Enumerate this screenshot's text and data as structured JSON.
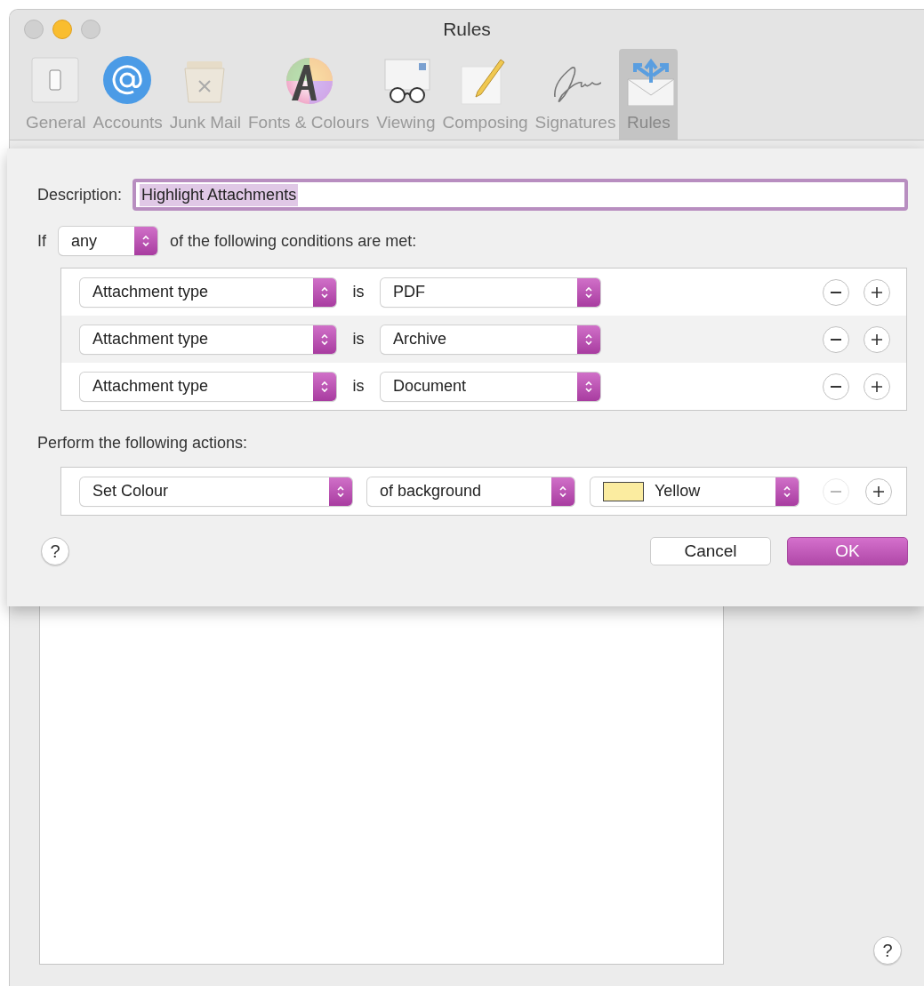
{
  "window": {
    "title": "Rules"
  },
  "toolbar": [
    {
      "label": "General",
      "selected": false
    },
    {
      "label": "Accounts",
      "selected": false
    },
    {
      "label": "Junk Mail",
      "selected": false
    },
    {
      "label": "Fonts & Colours",
      "selected": false
    },
    {
      "label": "Viewing",
      "selected": false
    },
    {
      "label": "Composing",
      "selected": false
    },
    {
      "label": "Signatures",
      "selected": false
    },
    {
      "label": "Rules",
      "selected": true
    }
  ],
  "sheet": {
    "description": {
      "label": "Description:",
      "value": "Highlight Attachments",
      "text_selected": true
    },
    "match": {
      "prefix": "If",
      "value": "any",
      "suffix": "of the following conditions are met:"
    },
    "conditions": [
      {
        "field": "Attachment type",
        "operator": "is",
        "value": "PDF"
      },
      {
        "field": "Attachment type",
        "operator": "is",
        "value": "Archive"
      },
      {
        "field": "Attachment type",
        "operator": "is",
        "value": "Document"
      }
    ],
    "actions_label": "Perform the following actions:",
    "actions": [
      {
        "action": "Set Colour",
        "target": "of background",
        "value": "Yellow",
        "color": "#fbeca0",
        "remove_disabled": true
      }
    ],
    "help": "?",
    "buttons": [
      {
        "label": "Cancel",
        "default": false
      },
      {
        "label": "OK",
        "default": true
      }
    ]
  },
  "window_help": "?"
}
